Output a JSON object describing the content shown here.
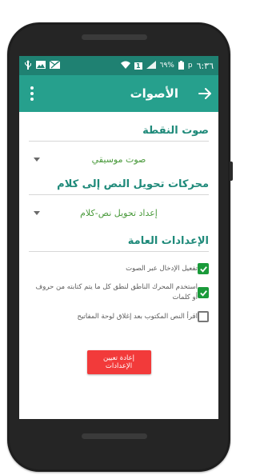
{
  "status_bar": {
    "time": "٦:٣٦",
    "ampm": "p",
    "battery": "٦٩%",
    "sim": "1"
  },
  "app_bar": {
    "title": "الأصوات"
  },
  "sections": {
    "point_sound": {
      "title": "صوت النقطة",
      "selected": "صوت موسيقي"
    },
    "tts_engines": {
      "title": "محركات تحويل النص إلى كلام",
      "selected": "إعداد تحويل نص-كلام"
    },
    "general": {
      "title": "الإعدادات العامة",
      "options": [
        {
          "label": "تفعيل الإدخال عبر الصوت",
          "checked": true
        },
        {
          "label": "استخدم المحرك الناطق لنطق كل ما يتم كتابته من حروف أو كلمات",
          "checked": true
        },
        {
          "label": "اقرأ النص المكتوب بعد إغلاق لوحة المفاتيح",
          "checked": false
        }
      ]
    }
  },
  "reset_button": {
    "label": "إعادة تعيين الإعدادات"
  },
  "colors": {
    "status_bar": "#1f8172",
    "app_bar": "#26a08d",
    "accent": "#1f8a7a",
    "checkbox": "#1a9a3a",
    "reset": "#f23a3a"
  }
}
